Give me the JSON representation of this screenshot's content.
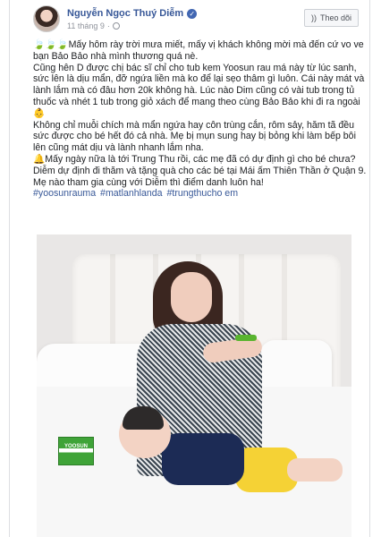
{
  "post": {
    "author": "Nguyễn Ngọc Thuý Diễm",
    "date": "11 tháng 9",
    "follow_label": "Theo dõi",
    "paragraphs": [
      "🍃🍃🍃Mấy hôm rày trời mưa miết, mấy vị khách không mời mà đến cứ vo ve bạn Bảo Bảo nhà mình thương quá nè.",
      "Cũng hên D được chị bác sĩ chỉ cho tub kem Yoosun rau má này từ lúc sanh, sức lên là dịu mẩn, đỡ ngứa liền mà ko để lại sẹo thâm gì luôn. Cái này mát và lành lắm mà có đâu hơn 20k không hà. Lúc nào Dim cũng có vài tub trong tủ thuốc và nhét 1 tub trong giỏ xách để mang theo cùng Bảo Bảo khi đi ra ngoài 👶",
      "Không chỉ muỗi chích mà mẩn ngứa hay côn trùng cắn, rôm sảy, hăm tã đều sức được cho bé hết đó cả nhà. Mẹ bị mụn sung hay bị bỏng khi làm bếp bôi lên cũng mát dịu và lành nhanh lắm nha.",
      "🔔Mấy ngày nữa là tới Trung Thu rồi, các mẹ đã có dự định gì cho bé chưa? Diễm dự định đi thăm và tặng quà cho các bé tại Mái ấm Thiên Thần ở Quận 9. Mẹ nào tham gia cùng với Diễm thì điểm danh luôn ha!"
    ],
    "hashtags": [
      "#yoosunrauma",
      "#matlanhlanda",
      "#trungthucho em"
    ],
    "photo": {
      "box_label": "YOOSUN"
    }
  },
  "colors": {
    "link": "#385898",
    "accent": "#4267b2",
    "meta": "#90949c"
  }
}
